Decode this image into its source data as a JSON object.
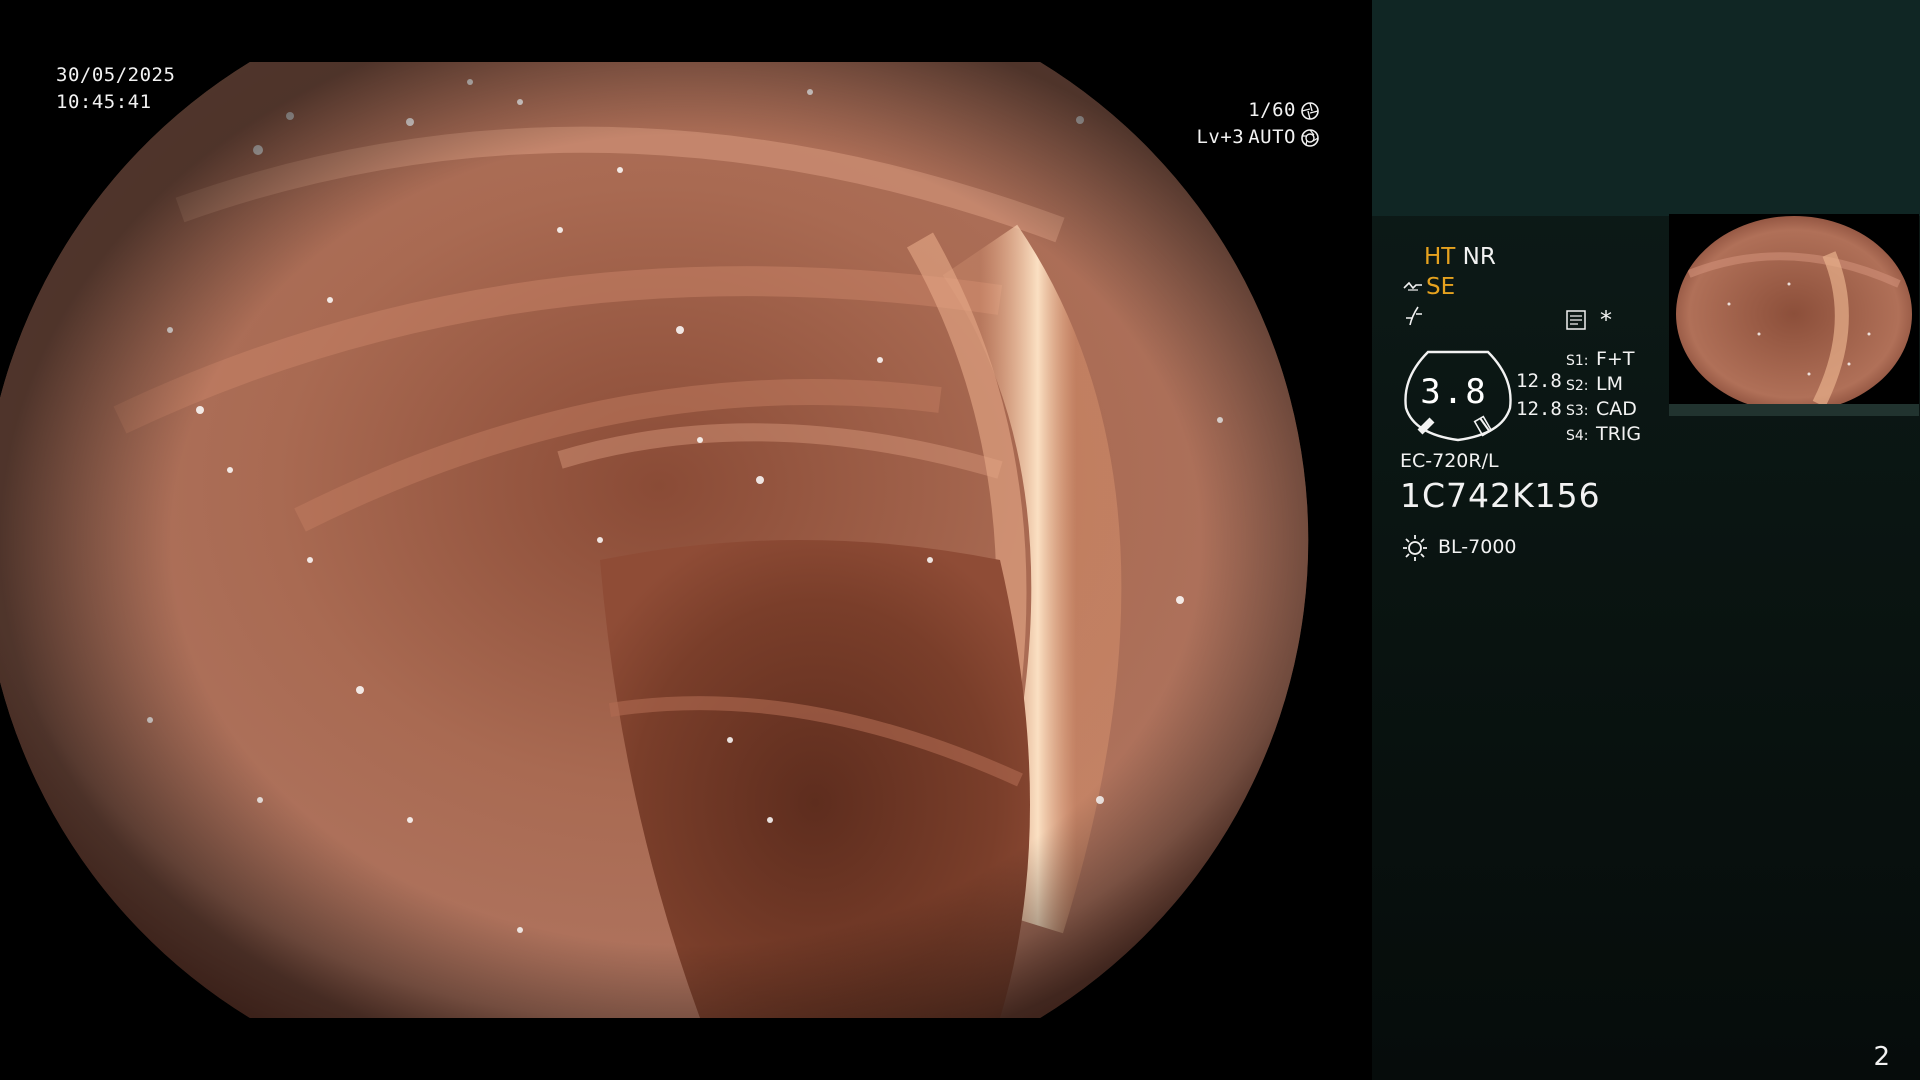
{
  "osd": {
    "date": "30/05/2025",
    "time": "10:45:41",
    "shutter": "1/60",
    "level": "Lv+3",
    "iris_mode": "AUTO"
  },
  "panel": {
    "ht": "HT",
    "nr": "NR",
    "se": "SE",
    "star": "*",
    "gauge_value": "3.8",
    "gauge_a": "12.8",
    "gauge_b": "12.8",
    "switches": [
      {
        "key": "S1:",
        "value": "F+T"
      },
      {
        "key": "S2:",
        "value": "LM"
      },
      {
        "key": "S3:",
        "value": "CAD"
      },
      {
        "key": "S4:",
        "value": "TRIG"
      }
    ],
    "scope_model": "EC-720R/L",
    "scope_serial": "1C742K156",
    "light_source": "BL-7000",
    "page_number": "2"
  },
  "colors": {
    "panel_bg": "#0a1614",
    "panel_header": "#102624",
    "amber": "#e6a21f",
    "tissue": "#9c5a44"
  }
}
